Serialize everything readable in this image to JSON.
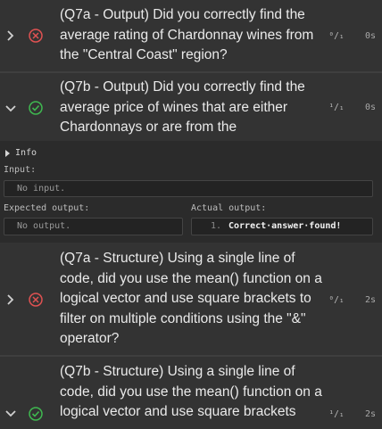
{
  "tests": [
    {
      "id": "q7a-output",
      "status": "fail",
      "text": "(Q7a - Output) Did you correctly find the average rating of Chardonnay wines from the \"Central Coast\" region?",
      "score": "⁰/₁",
      "time": "0s",
      "expanded": false
    },
    {
      "id": "q7b-output",
      "status": "pass",
      "text": "(Q7b - Output) Did you correctly find the average price of wines that are either Chardonnays or are from the",
      "score": "¹/₁",
      "time": "0s",
      "expanded": true
    },
    {
      "id": "q7a-structure",
      "status": "fail",
      "text": "(Q7a - Structure) Using a single line of code, did you use the mean() function on a logical vector and use square brackets to filter on multiple conditions using the \"&\" operator?",
      "score": "⁰/₁",
      "time": "2s",
      "expanded": false
    },
    {
      "id": "q7b-structure",
      "status": "pass",
      "text": "(Q7b - Structure) Using a single line of code, did you use the mean() function on a logical vector and use square brackets",
      "score": "¹/₁",
      "time": "2s",
      "expanded": true
    }
  ],
  "details": {
    "info_label": "Info",
    "input_label": "Input:",
    "input_value": "No input.",
    "expected_label": "Expected output:",
    "expected_value": "No output.",
    "actual_label": "Actual output:",
    "actual_line_no": "1.",
    "actual_value": "Correct·answer·found!"
  },
  "colors": {
    "fail": "#e05252",
    "pass": "#3fb950",
    "row_bg": "#333333",
    "page_bg": "#2b2b2b"
  },
  "icons": {
    "collapsed": "chevron-right-icon",
    "expanded": "chevron-down-icon",
    "fail": "x-circle-icon",
    "pass": "check-circle-icon"
  }
}
